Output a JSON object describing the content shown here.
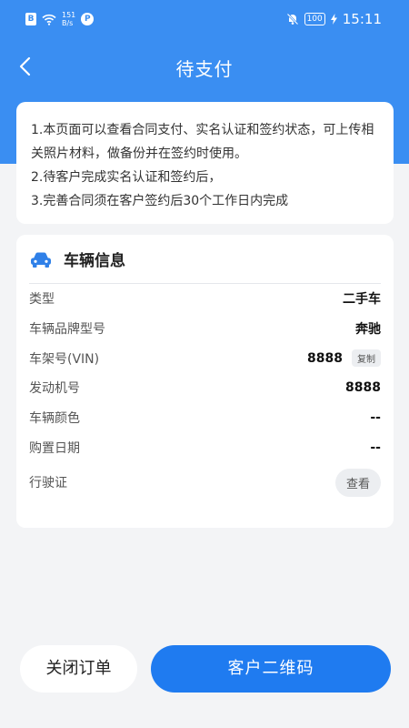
{
  "status_bar": {
    "sim_label": "B",
    "net_speed_value": "151",
    "net_speed_unit": "B/s",
    "app_badge": "P",
    "battery": "100",
    "time": "15:11"
  },
  "nav": {
    "title": "待支付"
  },
  "notice": {
    "lines": [
      "1.本页面可以查看合同支付、实名认证和签约状态，可上传相关照片材料，做备份并在签约时使用。",
      "2.待客户完成实名认证和签约后，",
      "3.完善合同须在客户签约后30个工作日内完成"
    ]
  },
  "vehicle": {
    "section_title": "车辆信息",
    "rows": [
      {
        "label": "类型",
        "value": "二手车"
      },
      {
        "label": "车辆品牌型号",
        "value": "奔驰"
      },
      {
        "label": "车架号(VIN)",
        "value": "8888",
        "action": "复制"
      },
      {
        "label": "发动机号",
        "value": "8888"
      },
      {
        "label": "车辆颜色",
        "value": "--"
      },
      {
        "label": "购置日期",
        "value": "--"
      },
      {
        "label": "行驶证",
        "action": "查看"
      }
    ]
  },
  "footer": {
    "close_order_label": "关闭订单",
    "qr_code_label": "客户二维码"
  }
}
